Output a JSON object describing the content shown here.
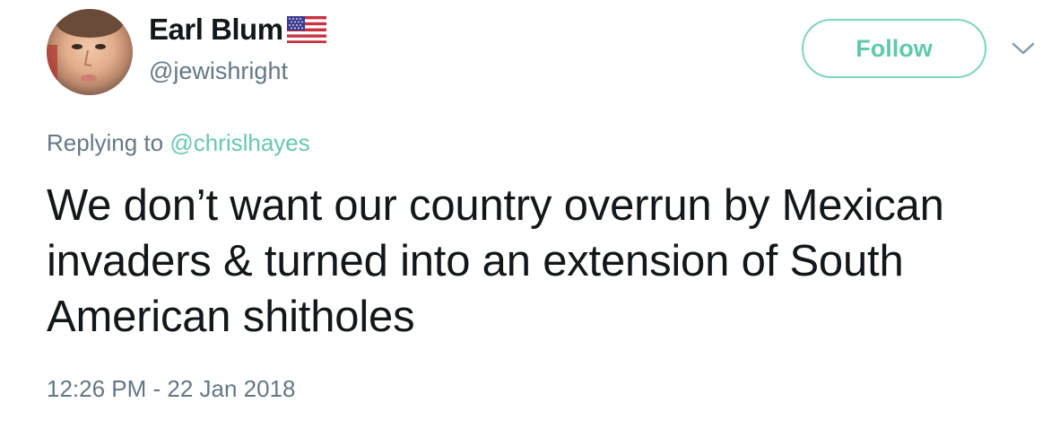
{
  "user": {
    "display_name": "Earl Blum",
    "handle": "@jewishright",
    "flag_icon": "us-flag-icon"
  },
  "actions": {
    "follow_label": "Follow",
    "more_icon": "chevron-down-icon"
  },
  "reply": {
    "prefix": "Replying to",
    "mention": "@chrislhayes"
  },
  "tweet": {
    "text": "We don’t want our country overrun by Mexican invaders & turned into an extension of South American shitholes",
    "timestamp": "12:26 PM - 22 Jan 2018"
  },
  "colors": {
    "accent": "#5fc9ab",
    "muted": "#657786",
    "text": "#14171a"
  }
}
